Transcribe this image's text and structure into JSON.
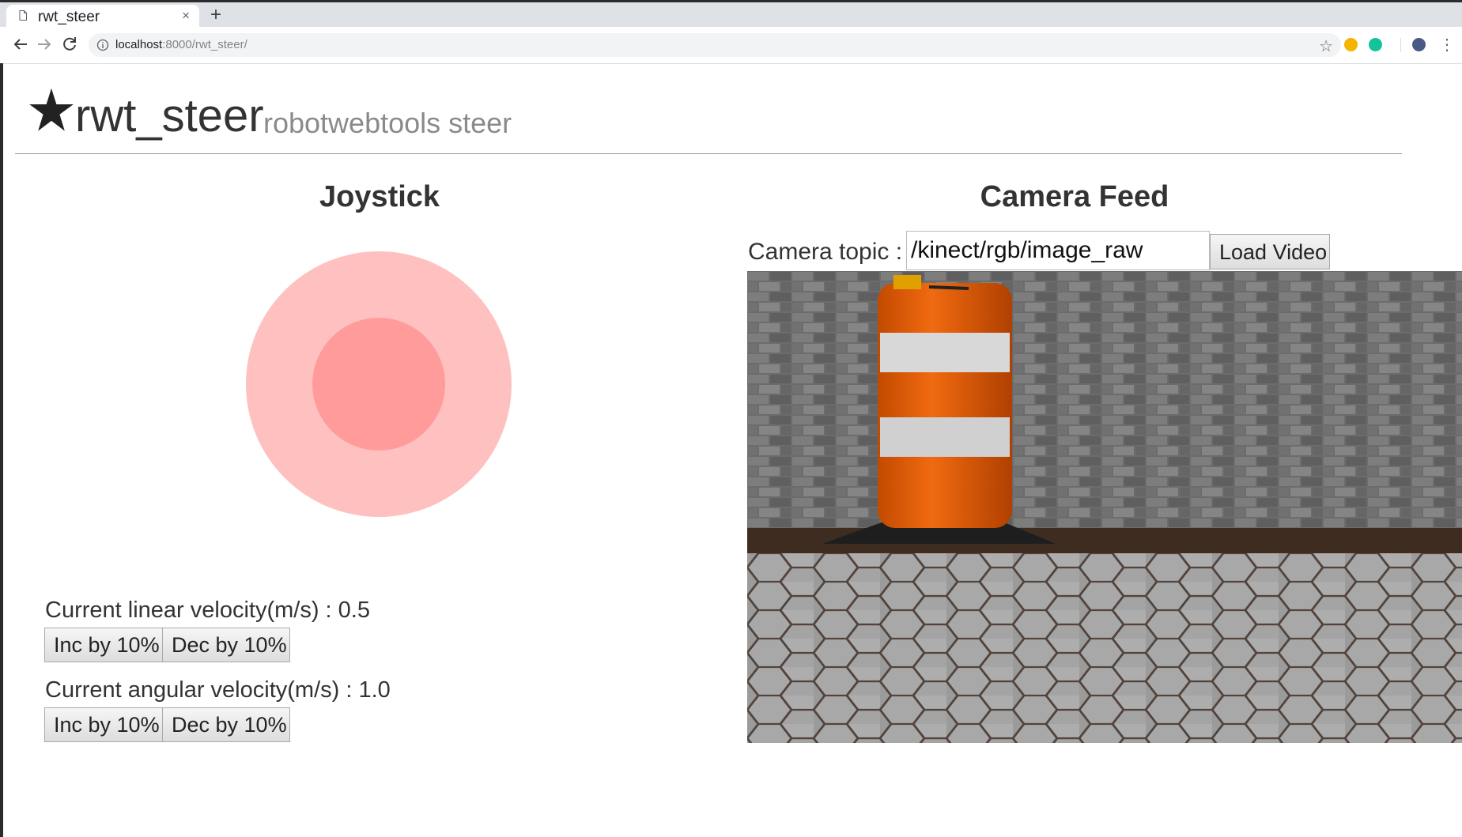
{
  "browser": {
    "tab_title": "rwt_steer",
    "tab_close": "×",
    "new_tab": "+",
    "url_host": "localhost",
    "url_rest": ":8000/rwt_steer/",
    "bookmark_star": "☆",
    "menu": "⋮"
  },
  "page": {
    "title": "rwt_steer",
    "subtitle": "robotwebtools steer"
  },
  "joystick": {
    "title": "Joystick",
    "outer_color": "#ffc0c0",
    "inner_color": "#ff9b9b"
  },
  "linear": {
    "label": "Current linear velocity(m/s) : 0.5",
    "inc_label": "Inc by 10%",
    "dec_label": "Dec by 10%"
  },
  "angular": {
    "label": "Current angular velocity(m/s) : 1.0",
    "inc_label": "Inc by 10%",
    "dec_label": "Dec by 10%"
  },
  "camera": {
    "title": "Camera Feed",
    "topic_label": "Camera topic :",
    "topic_value": "/kinect/rgb/image_raw",
    "load_button": "Load Video"
  },
  "icons": {
    "tab_favicon": "page-icon",
    "back": "back-arrow-icon",
    "forward": "forward-arrow-icon",
    "reload": "reload-icon",
    "site_info": "info-icon",
    "brand": "star-icon"
  }
}
